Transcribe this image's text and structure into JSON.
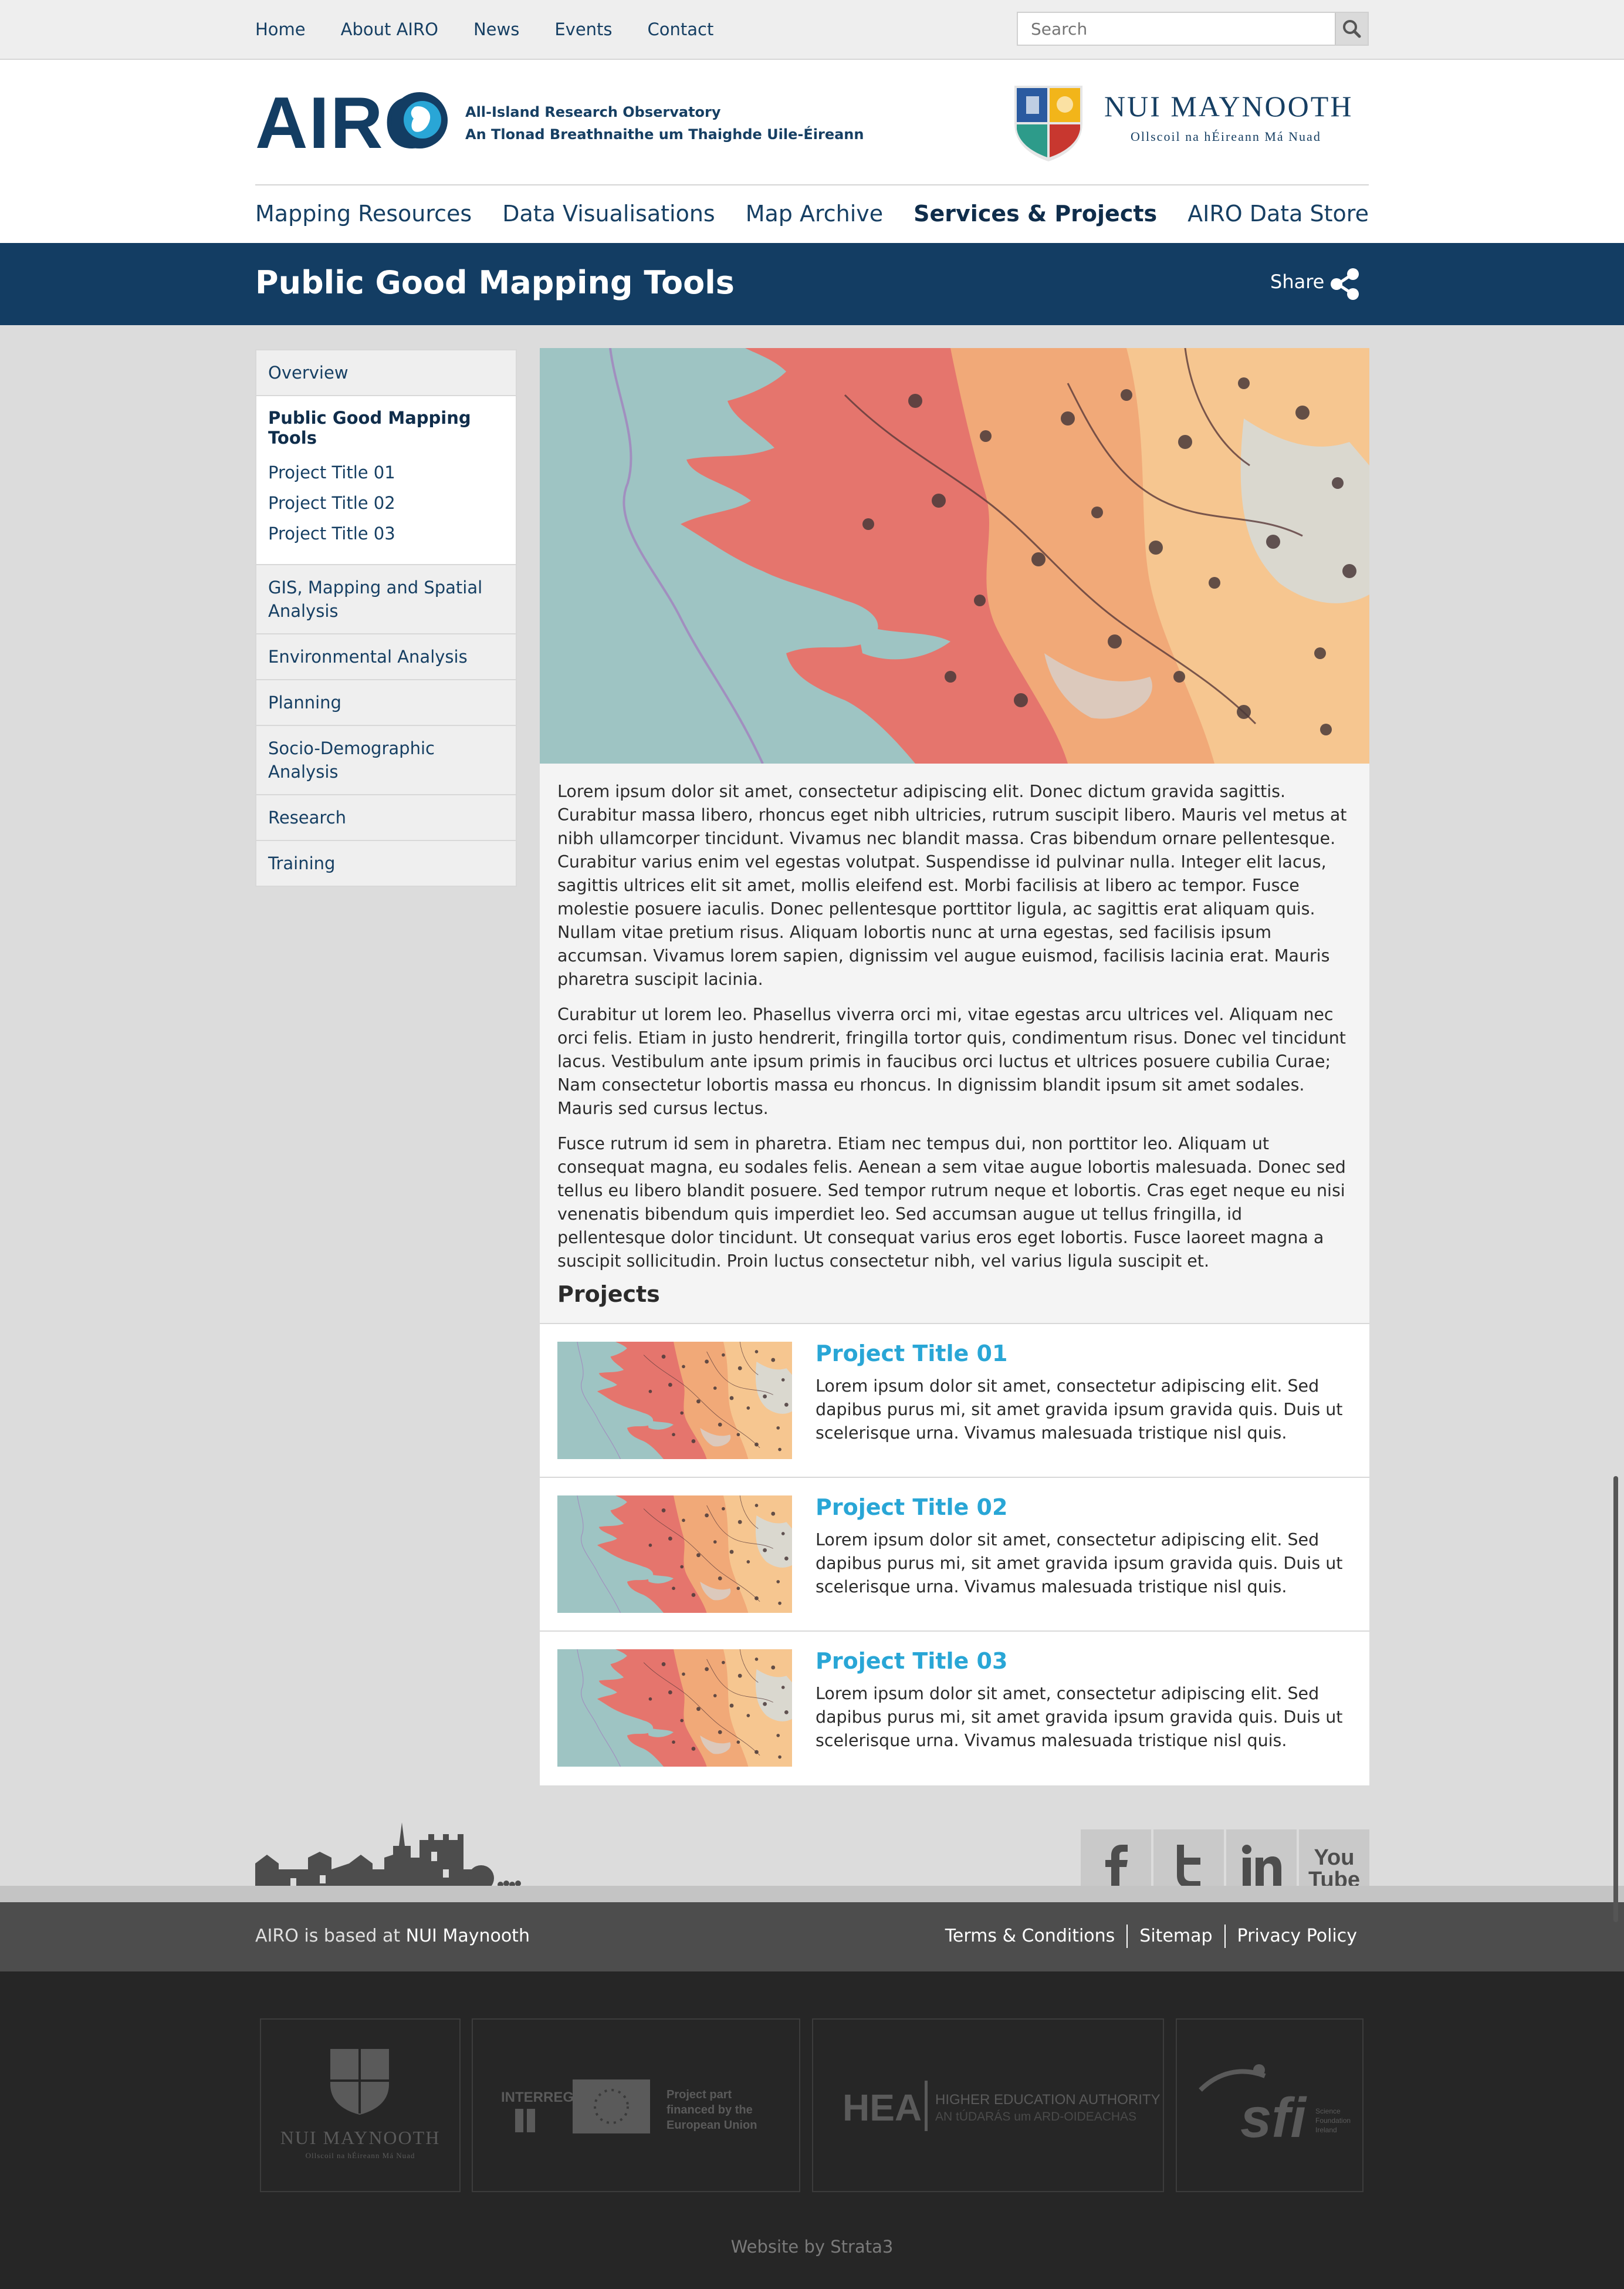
{
  "topnav": {
    "items": [
      "Home",
      "About AIRO",
      "News",
      "Events",
      "Contact"
    ],
    "search_placeholder": "Search"
  },
  "header": {
    "logo_text": "AIRO",
    "tagline_1": "All-Island Research Observatory",
    "tagline_2": "An Tlonad Breathnaithe um Thaighde Uile-Éireann",
    "university": "NUI MAYNOOTH",
    "university_sub": "Ollscoil na hÉireann Má Nuad"
  },
  "mainnav": {
    "items": [
      "Mapping Resources",
      "Data Visualisations",
      "Map Archive",
      "Services & Projects",
      "AIRO Data Store"
    ],
    "active": "Services & Projects"
  },
  "titleband": {
    "title": "Public Good Mapping Tools",
    "share_label": "Share"
  },
  "sidebar": {
    "overview": "Overview",
    "group_head": "Public Good Mapping Tools",
    "group_items": [
      "Project Title 01",
      "Project Title 02",
      "Project Title 03"
    ],
    "items": [
      "GIS, Mapping and Spatial Analysis",
      "Environmental Analysis",
      "Planning",
      "Socio-Demographic Analysis",
      "Research",
      "Training"
    ]
  },
  "main": {
    "paragraphs": [
      "Lorem ipsum dolor sit amet, consectetur adipiscing elit. Donec dictum gravida sagittis. Curabitur massa libero, rhoncus eget nibh ultricies, rutrum suscipit libero. Mauris vel metus at nibh ullamcorper tincidunt. Vivamus nec blandit massa. Cras bibendum ornare pellentesque. Curabitur varius enim vel egestas volutpat. Suspendisse id pulvinar nulla. Integer elit lacus, sagittis ultrices elit sit amet, mollis eleifend est. Morbi facilisis at libero ac tempor. Fusce molestie posuere iaculis. Donec pellentesque porttitor ligula, ac sagittis erat aliquam quis. Nullam vitae pretium risus. Aliquam lobortis nunc at urna egestas, sed facilisis ipsum accumsan. Vivamus lorem sapien, dignissim vel augue euismod, facilisis lacinia erat. Mauris pharetra suscipit lacinia.",
      "Curabitur ut lorem leo. Phasellus viverra orci mi, vitae egestas arcu ultrices vel. Aliquam nec orci felis. Etiam in justo hendrerit, fringilla tortor quis, condimentum risus. Donec vel tincidunt lacus. Vestibulum ante ipsum primis in faucibus orci luctus et ultrices posuere cubilia Curae; Nam consectetur lobortis massa eu rhoncus. In dignissim blandit ipsum sit amet sodales. Mauris sed cursus lectus.",
      "Fusce rutrum id sem in pharetra. Etiam nec tempus dui, non porttitor leo. Aliquam ut consequat magna, eu sodales felis. Aenean a sem vitae augue lobortis malesuada. Donec sed tellus eu libero blandit posuere. Sed tempor rutrum neque et lobortis. Cras eget neque eu nisi venenatis bibendum quis imperdiet leo. Sed accumsan augue ut tellus fringilla, id pellentesque dolor tincidunt. Ut consequat varius eros eget lobortis. Fusce laoreet magna a suscipit sollicitudin. Proin luctus consectetur nibh, vel varius ligula suscipit et."
    ],
    "projects_heading": "Projects",
    "projects": [
      {
        "title": "Project Title 01",
        "desc": "Lorem ipsum dolor sit amet, consectetur adipiscing elit. Sed dapibus purus mi, sit amet gravida ipsum gravida quis. Duis ut scelerisque urna. Vivamus malesuada tristique nisl quis."
      },
      {
        "title": "Project Title 02",
        "desc": "Lorem ipsum dolor sit amet, consectetur adipiscing elit. Sed dapibus purus mi, sit amet gravida ipsum gravida quis. Duis ut scelerisque urna. Vivamus malesuada tristique nisl quis."
      },
      {
        "title": "Project Title 03",
        "desc": "Lorem ipsum dolor sit amet, consectetur adipiscing elit. Sed dapibus purus mi, sit amet gravida ipsum gravida quis. Duis ut scelerisque urna. Vivamus malesuada tristique nisl quis."
      }
    ]
  },
  "footer": {
    "based_prefix": "AIRO is based at",
    "based_link": "NUI Maynooth",
    "legal": [
      "Terms & Conditions",
      "Sitemap",
      "Privacy Policy"
    ],
    "social": [
      "facebook-icon",
      "twitter-icon",
      "linkedin-icon",
      "youtube-icon"
    ],
    "partners": {
      "nui": "NUI MAYNOOTH",
      "nui_sub": "Ollscoil na hÉireann Má Nuad",
      "interreg": "INTERREG",
      "interreg_text_1": "Project part",
      "interreg_text_2": "financed by the",
      "interreg_text_3": "European Union",
      "hea": "HEA",
      "hea_text_1": "HIGHER EDUCATION AUTHORITY",
      "hea_text_2": "AN tÚDARÁS um ARD-OIDEACHAS",
      "sfi": "sfi",
      "sfi_text_1": "Science",
      "sfi_text_2": "Foundation",
      "sfi_text_3": "Ireland"
    },
    "credit": "Website by Strata3"
  },
  "colors": {
    "navy": "#133d63",
    "link_blue": "#29a6d6",
    "page_bg": "#dcdcdc",
    "footer_dark": "#262626"
  }
}
